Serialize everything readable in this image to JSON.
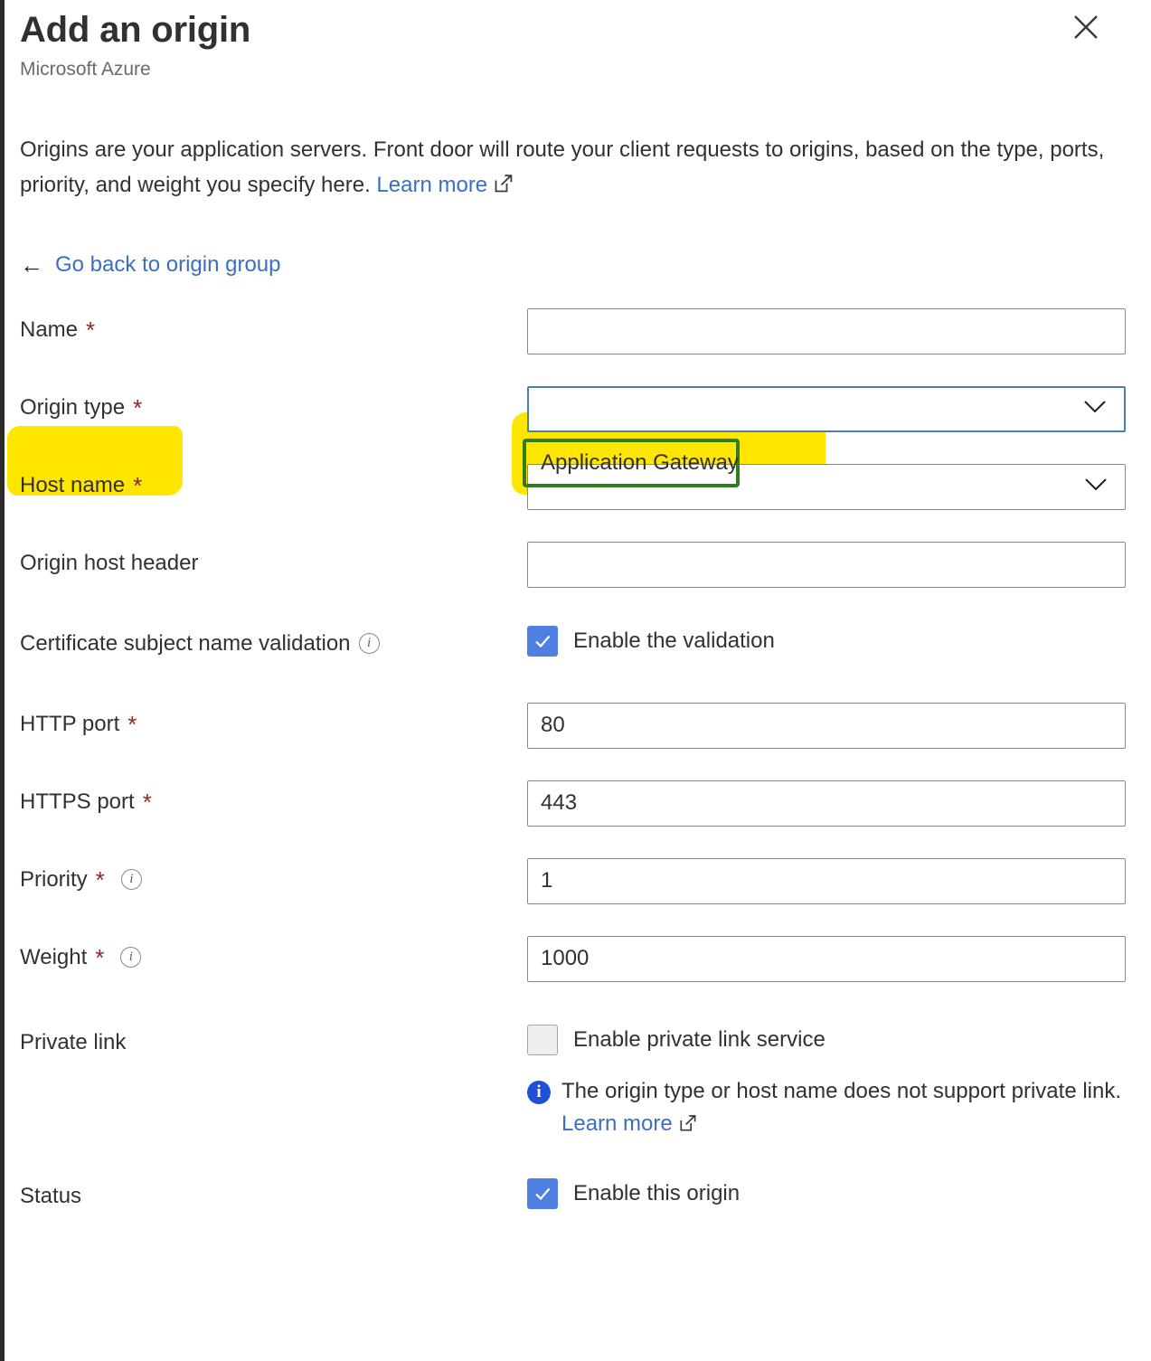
{
  "header": {
    "title": "Add an origin",
    "subtitle": "Microsoft Azure",
    "close_icon": "close-icon"
  },
  "description": {
    "text": "Origins are your application servers. Front door will route your client requests to origins, based on the type, ports, priority, and weight you specify here.",
    "learn_more_label": "Learn more",
    "external_icon": "external-link-icon"
  },
  "back_link": {
    "arrow": "←",
    "label": "Go back to origin group"
  },
  "form": {
    "name": {
      "label": "Name",
      "required": "*",
      "value": "",
      "placeholder": ""
    },
    "origin_type": {
      "label": "Origin type",
      "required": "*",
      "value": "Application Gateway",
      "chevron_icon": "chevron-down-icon",
      "highlighted": "true",
      "focused": "true"
    },
    "host_name": {
      "label": "Host name",
      "required": "*",
      "value": "",
      "chevron_icon": "chevron-down-icon"
    },
    "origin_host_header": {
      "label": "Origin host header",
      "value": "",
      "placeholder": ""
    },
    "cert_validation": {
      "label": "Certificate subject name validation",
      "info_icon": "info-icon",
      "checkbox_label": "Enable the validation",
      "checked": true
    },
    "http_port": {
      "label": "HTTP port",
      "required": "*",
      "value": "80"
    },
    "https_port": {
      "label": "HTTPS port",
      "required": "*",
      "value": "443"
    },
    "priority": {
      "label": "Priority",
      "required": "*",
      "info_icon": "info-icon",
      "value": "1"
    },
    "weight": {
      "label": "Weight",
      "required": "*",
      "info_icon": "info-icon",
      "value": "1000"
    },
    "private_link": {
      "label": "Private link",
      "checkbox_label": "Enable private link service",
      "checked": false,
      "message_icon": "info-filled-icon",
      "message": "The origin type or host name does not support private link.",
      "message_link": "Learn more",
      "external_icon": "external-link-icon"
    },
    "status": {
      "label": "Status",
      "checkbox_label": "Enable this origin",
      "checked": true
    }
  },
  "colors": {
    "link": "#3a6fc4",
    "required_asterisk": "#8c2a2a",
    "checkbox_on": "#4f7fe0",
    "focus_border": "#4a7ebb",
    "highlight_yellow": "#ffe600",
    "annotation_green": "#2f7d1f",
    "info_badge_blue": "#1f4fd8"
  }
}
